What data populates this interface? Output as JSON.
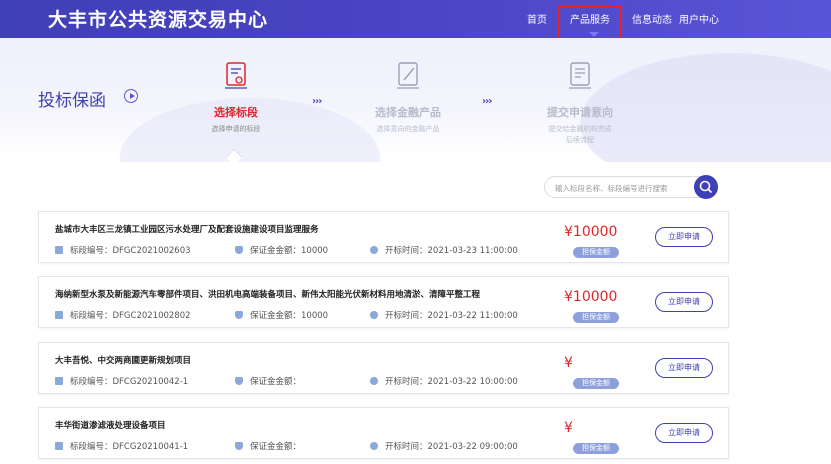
{
  "header": {
    "site_title": "大丰市公共资源交易中心",
    "nav": [
      "首页",
      "产品服务",
      "信息动态",
      "用户中心"
    ],
    "active_nav": "产品服务"
  },
  "banner": {
    "title": "投标保函",
    "steps": [
      {
        "title": "选择标段",
        "sub": "选择申请的标段",
        "state": "active"
      },
      {
        "title": "选择金融产品",
        "sub": "选择意向的金融产品",
        "state": "inactive"
      },
      {
        "title": "提交申请意向",
        "sub": "提交给金融机构完成后续流程",
        "sub_line1": "提交给金融机构完成",
        "sub_line2": "后续流程",
        "state": "inactive"
      }
    ],
    "separator": "›››"
  },
  "search": {
    "placeholder": "输入标段名称、标段编号进行搜索"
  },
  "items": [
    {
      "title": "盐城市大丰区三龙镇工业园区污水处理厂及配套设施建设项目监理服务",
      "code_label": "标段编号：DFGC2021002603",
      "bond_label": "保证金金额：10000",
      "open_label": "开标时间：2021-03-23 11:00:00",
      "price": "¥10000",
      "price_tag": "担保金额",
      "apply": "立即申请"
    },
    {
      "title": "海纳新型水泵及新能源汽车零部件项目、洪田机电高端装备项目、新伟太阳能光伏新材料用地清淤、清障平整工程",
      "code_label": "标段编号：DFGC2021002802",
      "bond_label": "保证金金额：10000",
      "open_label": "开标时间：2021-03-22 11:00:00",
      "price": "¥10000",
      "price_tag": "担保金额",
      "apply": "立即申请"
    },
    {
      "title": "大丰吾悦、中交两商圃更新规划项目",
      "code_label": "标段编号：DFCG20210042-1",
      "bond_label": "保证金金额：",
      "open_label": "开标时间：2021-03-22 10:00:00",
      "price": "¥",
      "price_tag": "担保金额",
      "apply": "立即申请"
    },
    {
      "title": "丰华街道渗滤液处理设备项目",
      "code_label": "标段编号：DFCG20210041-1",
      "bond_label": "保证金金额：",
      "open_label": "开标时间：2021-03-22 09:00:00",
      "price": "¥",
      "price_tag": "担保金额",
      "apply": "立即申请"
    }
  ],
  "colors": {
    "brand": "#3f3fb6",
    "accent_red": "#e0262b",
    "tag": "#8ea0dc"
  }
}
